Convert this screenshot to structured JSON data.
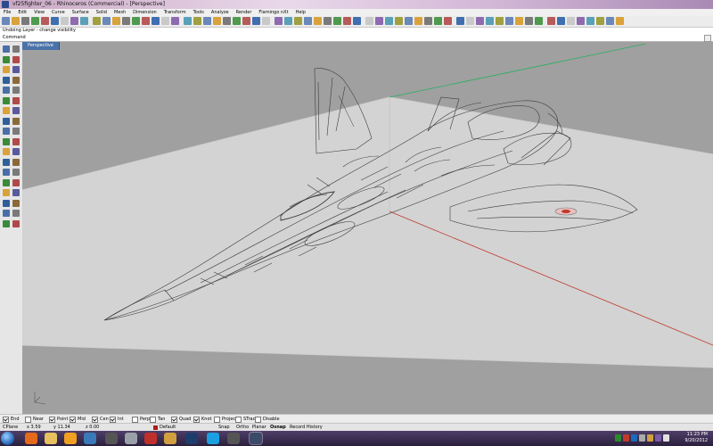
{
  "window": {
    "title": "vf25fighter_06 - Rhinoceros (Commercial) - [Perspective]"
  },
  "menu": [
    "File",
    "Edit",
    "View",
    "Curve",
    "Surface",
    "Solid",
    "Mesh",
    "Dimension",
    "Transform",
    "Tools",
    "Analyze",
    "Render",
    "Flamingo nXt",
    "Help"
  ],
  "command_history": "Undoing Layer - change visibility",
  "command_prompt": "Command",
  "viewport": {
    "tab_label": "Perspective",
    "background_color": "#a0a0a0",
    "plane_color": "#d3d3d3",
    "x_axis_color": "#c0392b",
    "y_axis_color": "#27ae60",
    "linework_color": "#3c3c3c"
  },
  "osnaps": [
    {
      "label": "End",
      "checked": true
    },
    {
      "label": "Near",
      "checked": false
    },
    {
      "label": "Point",
      "checked": true
    },
    {
      "label": "Mid",
      "checked": true
    },
    {
      "label": "Cen",
      "checked": true
    },
    {
      "label": "Int",
      "checked": true
    },
    {
      "label": "Perp",
      "checked": false
    },
    {
      "label": "Tan",
      "checked": false
    },
    {
      "label": "Quad",
      "checked": true
    },
    {
      "label": "Knot",
      "checked": true
    },
    {
      "label": "Project",
      "checked": false
    },
    {
      "label": "STrack",
      "checked": false
    },
    {
      "label": "Disable",
      "checked": false
    }
  ],
  "status": {
    "cplane": "CPlane",
    "x": "x 3.59",
    "y": "y 11.34",
    "z": "z 0.00",
    "layer": "Default",
    "layer_color": "#b01818",
    "snap": "Snap",
    "ortho": "Ortho",
    "planar": "Planar",
    "osnap": "Osnap",
    "record_history": "Record History"
  },
  "taskbar": {
    "time": "11:23 PM",
    "date": "9/20/2012",
    "apps": [
      {
        "icon": "firefox-icon",
        "color": "#e66a1c"
      },
      {
        "icon": "explorer-icon",
        "color": "#e8c060"
      },
      {
        "icon": "media-player-icon",
        "color": "#f0a020"
      },
      {
        "icon": "image-viewer-icon",
        "color": "#3a7ab8"
      },
      {
        "icon": "game-icon",
        "color": "#555555"
      },
      {
        "icon": "settings-icon",
        "color": "#9aa0a8"
      },
      {
        "icon": "shield-app-icon",
        "color": "#c0302a"
      },
      {
        "icon": "globe-icon",
        "color": "#d0a040"
      },
      {
        "icon": "photoshop-icon",
        "color": "#1d3e6c"
      },
      {
        "icon": "skype-icon",
        "color": "#1aa0e0"
      },
      {
        "icon": "zbrush-icon",
        "color": "#555555"
      },
      {
        "icon": "rhino-icon",
        "color": "#3c4a6a"
      }
    ]
  }
}
